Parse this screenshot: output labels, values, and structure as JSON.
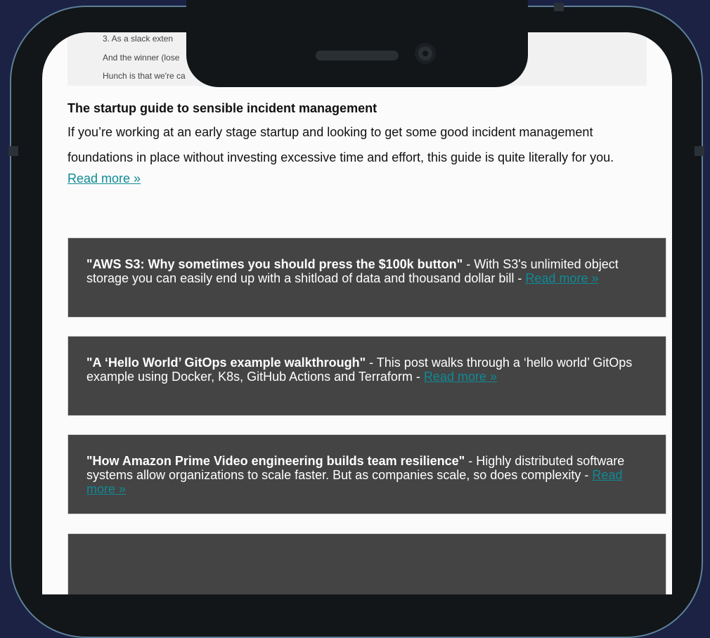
{
  "previous_snippet": {
    "lines": [
      "3.  As a slack exten",
      "And the winner (lose",
      "Hunch is that we're ca"
    ]
  },
  "feature": {
    "title": "The startup guide to sensible incident management",
    "description": "If you’re working at an early stage startup and looking to get some good incident management foundations in place without investing excessive time and effort, this guide is quite literally for you.",
    "link": "Read more »"
  },
  "cards": [
    {
      "title": "\"AWS S3: Why sometimes you should press the $100k button\"",
      "separator": " - ",
      "description": "With S3's unlimited object storage you can easily end up with a shitload of data and thousand dollar bill",
      "link": "Read more »"
    },
    {
      "title": "\"A ‘Hello World’ GitOps example walkthrough\"",
      "separator": " - ",
      "description": "This post walks through a ‘hello world’ GitOps example using Docker, K8s, GitHub Actions and Terraform",
      "link": "Read more »"
    },
    {
      "title": "\"How Amazon Prime Video engineering builds team resilience\"",
      "separator": " - ",
      "description": "Highly distributed software systems allow organizations to scale faster. But as companies scale, so does complexity",
      "link": "Read more »"
    }
  ]
}
